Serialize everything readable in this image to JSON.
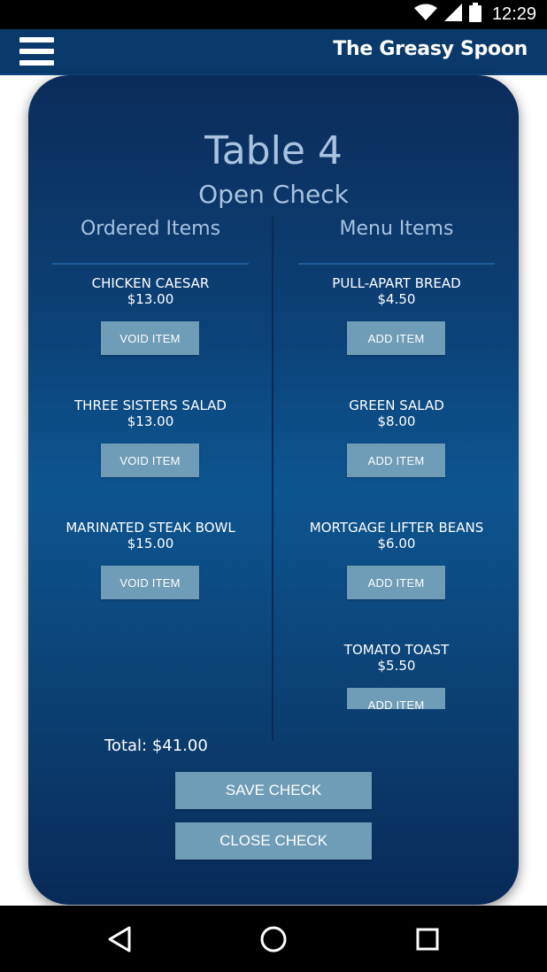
{
  "status_bar": {
    "time": "12:29"
  },
  "app_bar": {
    "title": "The Greasy Spoon"
  },
  "check": {
    "table": "Table 4",
    "status": "Open Check",
    "ordered_heading": "Ordered Items",
    "menu_heading": "Menu Items",
    "total": "Total: $41.00",
    "save_label": "SAVE CHECK",
    "close_label": "CLOSE CHECK"
  },
  "ordered_items": [
    {
      "name": "CHICKEN CAESAR",
      "price": "$13.00",
      "action": "VOID ITEM"
    },
    {
      "name": "THREE SISTERS SALAD",
      "price": "$13.00",
      "action": "VOID ITEM"
    },
    {
      "name": "MARINATED STEAK BOWL",
      "price": "$15.00",
      "action": "VOID ITEM"
    }
  ],
  "menu_items": [
    {
      "name": "PULL-APART BREAD",
      "price": "$4.50",
      "action": "ADD ITEM"
    },
    {
      "name": "GREEN SALAD",
      "price": "$8.00",
      "action": "ADD ITEM"
    },
    {
      "name": "MORTGAGE LIFTER BEANS",
      "price": "$6.00",
      "action": "ADD ITEM"
    },
    {
      "name": "TOMATO TOAST",
      "price": "$5.50",
      "action": "ADD ITEM"
    }
  ],
  "icons": {
    "menu": "hamburger-menu-icon",
    "wifi": "wifi-icon",
    "signal": "cell-signal-icon",
    "battery": "battery-icon",
    "back": "back-triangle-icon",
    "home": "home-circle-icon",
    "recents": "recents-square-icon"
  },
  "colors": {
    "app_bar": "#0a3a6b",
    "card_top": "#0b2c5a",
    "card_mid": "#0d5590",
    "button": "#6f9cb7",
    "heading_text": "#a8c2e0"
  }
}
